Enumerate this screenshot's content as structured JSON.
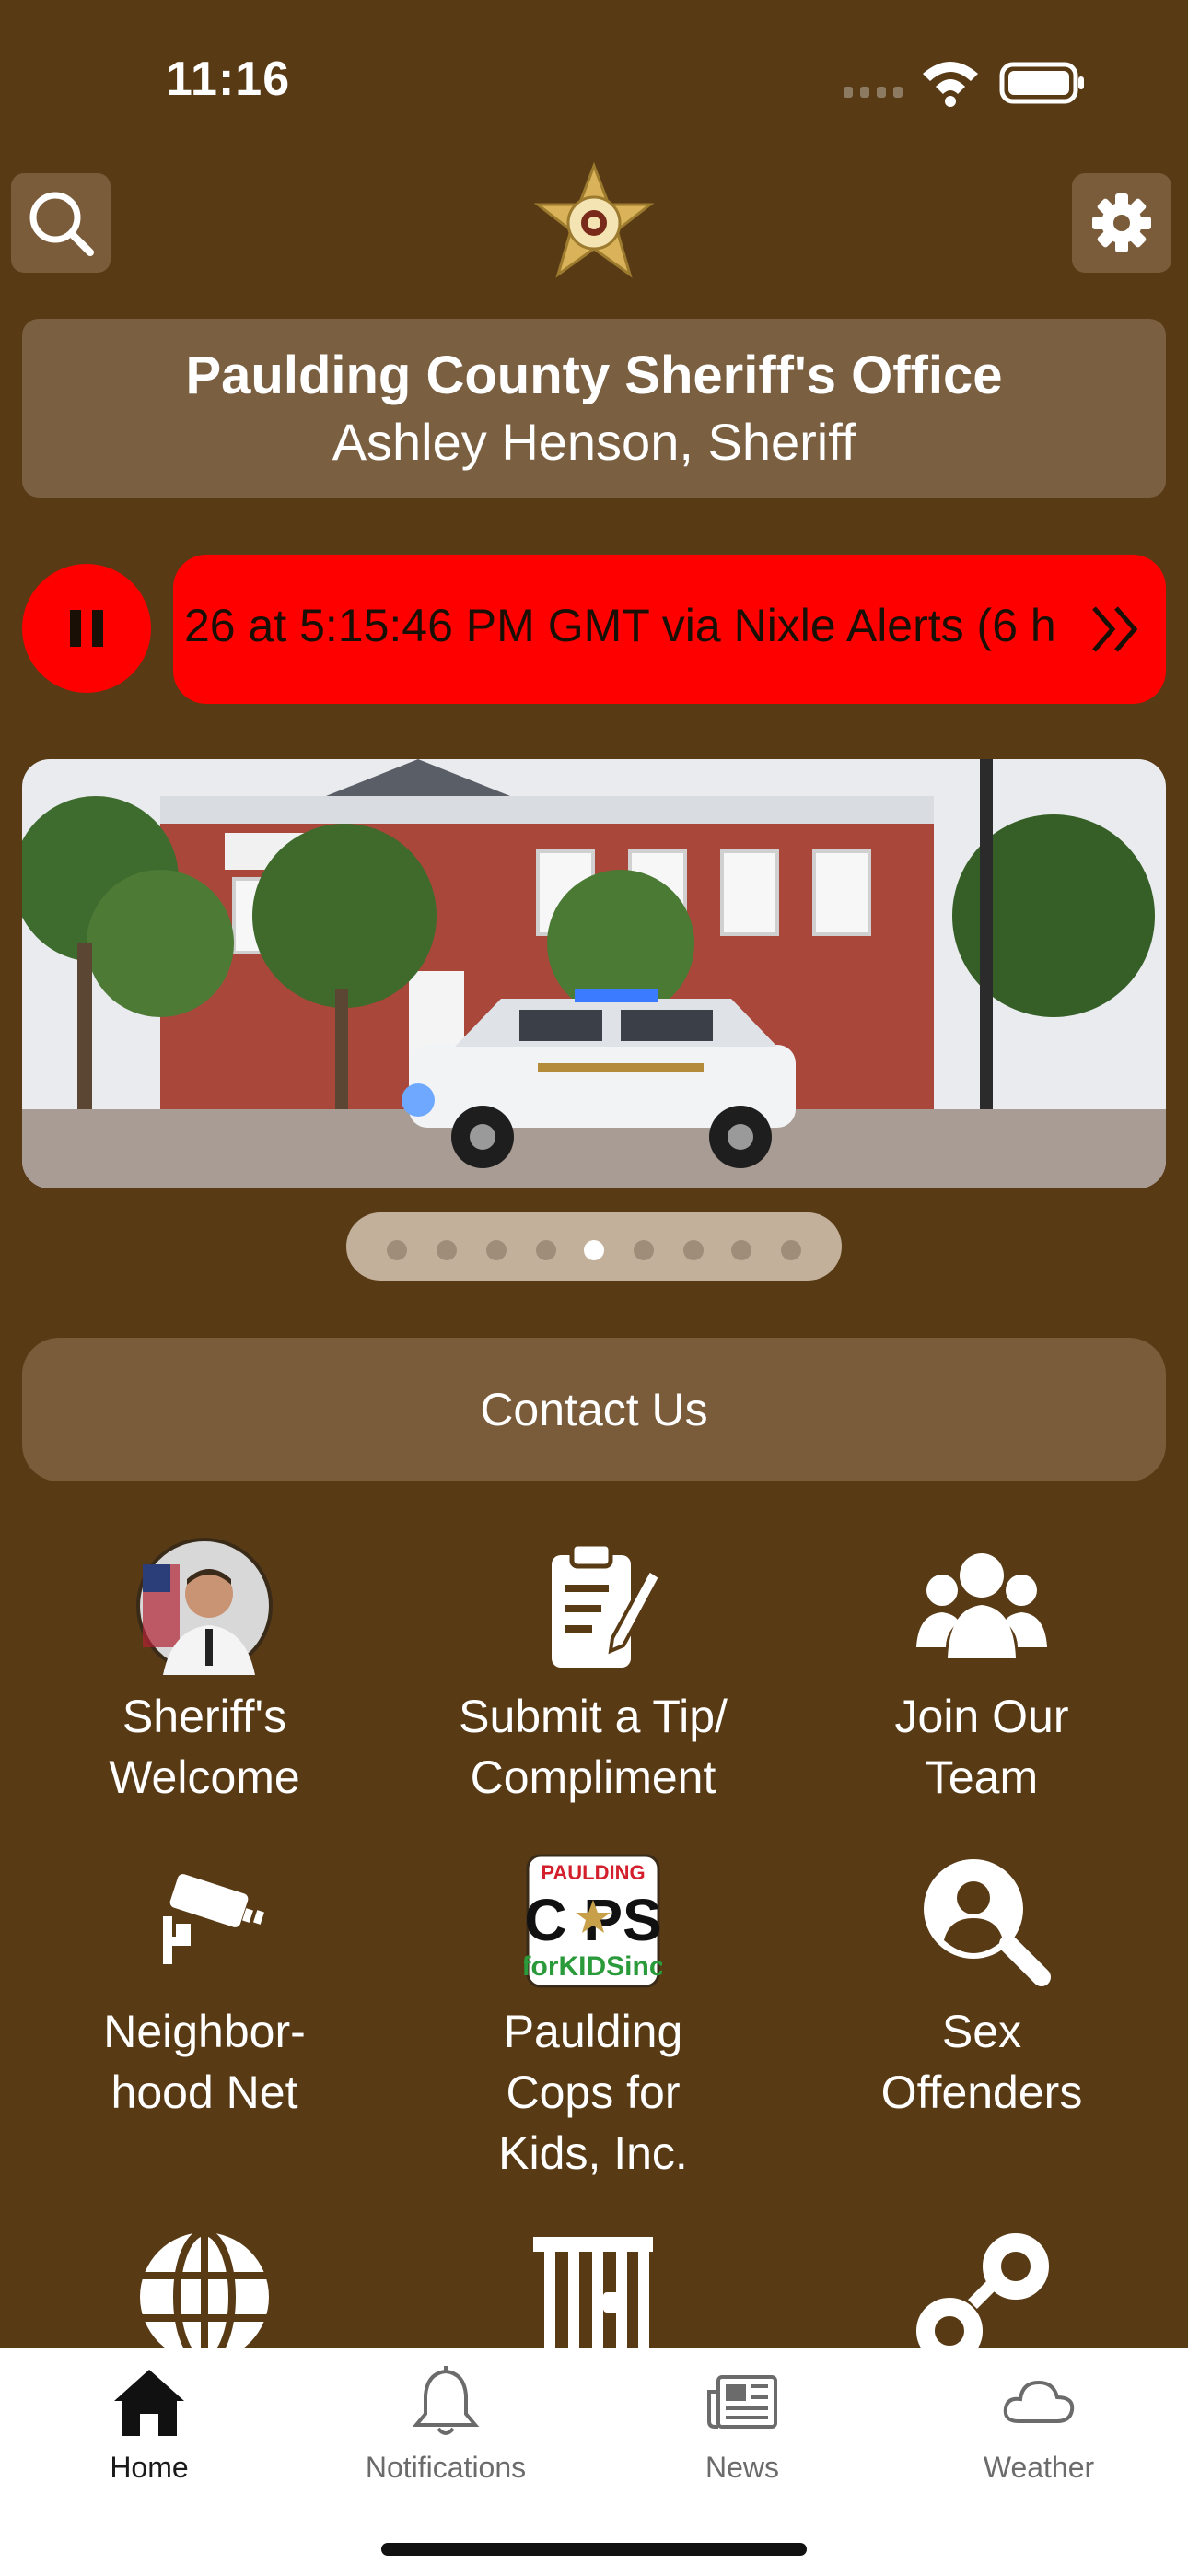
{
  "status_bar": {
    "time": "11:16"
  },
  "header": {
    "title": "Paulding County Sheriff's Office",
    "subtitle": "Ashley Henson, Sheriff"
  },
  "ticker": {
    "text": "26 at 5:15:46 PM GMT via Nixle Alerts (6 h",
    "color": "#ff0000"
  },
  "carousel": {
    "page_count": 9,
    "active_index": 4
  },
  "contact": {
    "label": "Contact Us"
  },
  "grid": [
    {
      "label": "Sheriff's\nWelcome",
      "icon": "sheriff-photo-icon"
    },
    {
      "label": "Submit a Tip/\nCompliment",
      "icon": "clipboard-pen-icon"
    },
    {
      "label": "Join Our\nTeam",
      "icon": "people-group-icon"
    },
    {
      "label": "Neighbor-\nhood Net",
      "icon": "security-camera-icon"
    },
    {
      "label": "Paulding\nCops for\nKids, Inc.",
      "icon": "cops-for-kids-logo-icon"
    },
    {
      "label": "Sex\nOffenders",
      "icon": "search-person-icon"
    },
    {
      "label": "",
      "icon": "globe-icon"
    },
    {
      "label": "",
      "icon": "jail-bars-icon"
    },
    {
      "label": "",
      "icon": "handcuffs-icon"
    }
  ],
  "cops_logo": {
    "line1": "PAULDING",
    "line2": "C PS",
    "line3": "forKIDSinc"
  },
  "tabs": [
    {
      "label": "Home",
      "icon": "home-icon"
    },
    {
      "label": "Notifications",
      "icon": "bell-icon"
    },
    {
      "label": "News",
      "icon": "newspaper-icon"
    },
    {
      "label": "Weather",
      "icon": "cloud-icon"
    }
  ],
  "colors": {
    "background": "#583a15",
    "card": "#7a5f41",
    "alert": "#ff0000"
  }
}
